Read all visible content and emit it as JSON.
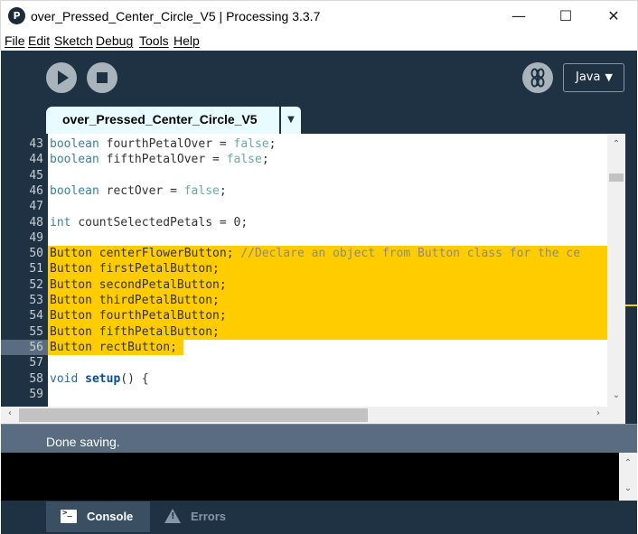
{
  "window": {
    "title": "over_Pressed_Center_Circle_V5 | Processing 3.3.7",
    "app_icon": "P",
    "min_glyph": "—",
    "max_glyph": "☐",
    "close_glyph": "✕"
  },
  "menu": [
    "File",
    "Edit",
    "Sketch",
    "Debug",
    "Tools",
    "Help"
  ],
  "toolbar": {
    "run_icon": "play-icon",
    "stop_icon": "stop-icon",
    "debug_icon": "butterfly-icon",
    "mode_label": "Java",
    "mode_arrow": "▼"
  },
  "tabs": {
    "active_label": "over_Pressed_Center_Circle_V5",
    "menu_arrow": "▼"
  },
  "editor": {
    "current_line": 56,
    "lines": [
      {
        "n": "43",
        "text": "boolean fourthPetalOver = false;"
      },
      {
        "n": "44",
        "text": "boolean fifthPetalOver = false;"
      },
      {
        "n": "45",
        "text": ""
      },
      {
        "n": "46",
        "text": "boolean rectOver = false;"
      },
      {
        "n": "47",
        "text": ""
      },
      {
        "n": "48",
        "text": "int countSelectedPetals = 0;"
      },
      {
        "n": "49",
        "text": ""
      },
      {
        "n": "50",
        "text": "Button centerFlowerButton; //Declare an object from Button class for the ce"
      },
      {
        "n": "51",
        "text": "Button firstPetalButton;"
      },
      {
        "n": "52",
        "text": "Button secondPetalButton;"
      },
      {
        "n": "53",
        "text": "Button thirdPetalButton;"
      },
      {
        "n": "54",
        "text": "Button fourthPetalButton;"
      },
      {
        "n": "55",
        "text": "Button fifthPetalButton;"
      },
      {
        "n": "56",
        "text": "Button rectButton;"
      },
      {
        "n": "57",
        "text": ""
      },
      {
        "n": "58",
        "text": "void setup() {"
      },
      {
        "n": "59",
        "text": ""
      }
    ],
    "highlight_color": "#ffcc00"
  },
  "status": {
    "message": "Done saving."
  },
  "footer": {
    "console_label": "Console",
    "errors_label": "Errors"
  },
  "colors": {
    "toolbar_bg": "#1e3244",
    "status_bg": "#5a6d80",
    "tab_bg": "#e8fbff"
  }
}
